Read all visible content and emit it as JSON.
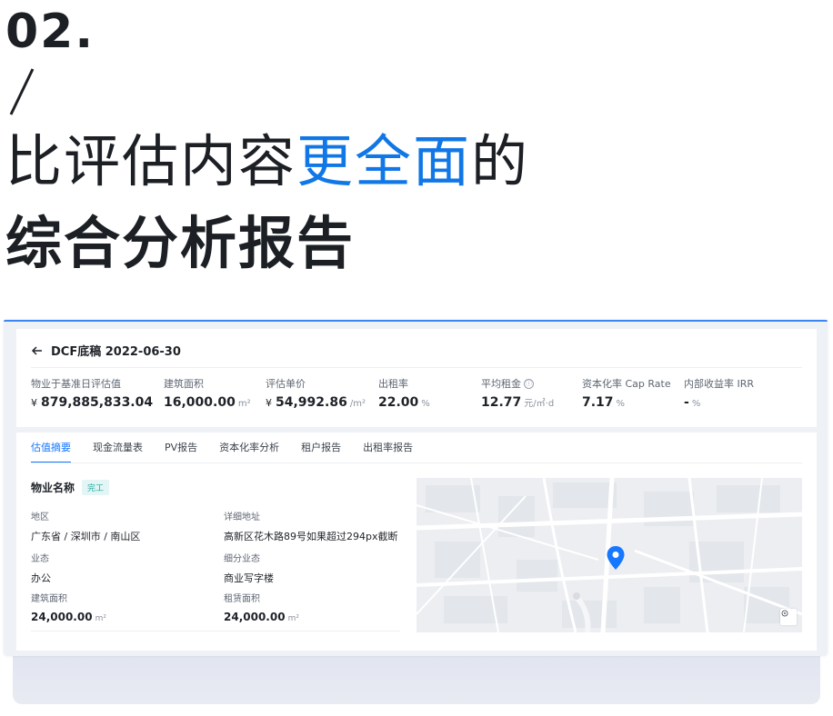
{
  "hero": {
    "number": "02.",
    "line1_prefix": "比评估内容",
    "line1_highlight": "更全面",
    "line1_suffix": "的",
    "line2": "综合分析报告",
    "highlight_color": "#1177e6"
  },
  "header": {
    "back_icon": "arrow-left-icon",
    "title": "DCF底稿 2022-06-30"
  },
  "metrics": [
    {
      "label": "物业于基准日评估值",
      "prefix": "¥",
      "value": "879,885,833.04",
      "unit": ""
    },
    {
      "label": "建筑面积",
      "prefix": "",
      "value": "16,000.00",
      "unit": "m²"
    },
    {
      "label": "评估单价",
      "prefix": "¥",
      "value": "54,992.86",
      "unit": "/m²"
    },
    {
      "label": "出租率",
      "prefix": "",
      "value": "22.00",
      "unit": "%"
    },
    {
      "label": "平均租金",
      "prefix": "",
      "value": "12.77",
      "unit": "元/㎡·d",
      "info": "ⓘ"
    },
    {
      "label": "资本化率 Cap Rate",
      "prefix": "",
      "value": "7.17",
      "unit": "%"
    },
    {
      "label": "内部收益率 IRR",
      "prefix": "",
      "value": "-",
      "unit": "%"
    }
  ],
  "tabs": [
    "估值摘要",
    "现金流量表",
    "PV报告",
    "资本化率分析",
    "租户报告",
    "出租率报告"
  ],
  "active_tab": 0,
  "property": {
    "title": "物业名称",
    "status_tag": "完工",
    "fields": {
      "region_label": "地区",
      "region_value": "广东省 / 深圳市 / 南山区",
      "address_label": "详细地址",
      "address_value": "高新区花木路89号如果超过294px截断",
      "type_label": "业态",
      "type_value": "办公",
      "subtype_label": "细分业态",
      "subtype_value": "商业写字楼",
      "gfa_label": "建筑面积",
      "gfa_value": "24,000.00",
      "gfa_unit": "m²",
      "lease_label": "租赁面积",
      "lease_value": "24,000.00",
      "lease_unit": "m²"
    }
  },
  "map": {
    "pin_icon": "map-pin-icon",
    "locate_icon": "locate-icon",
    "pin_color": "#1677ff"
  }
}
